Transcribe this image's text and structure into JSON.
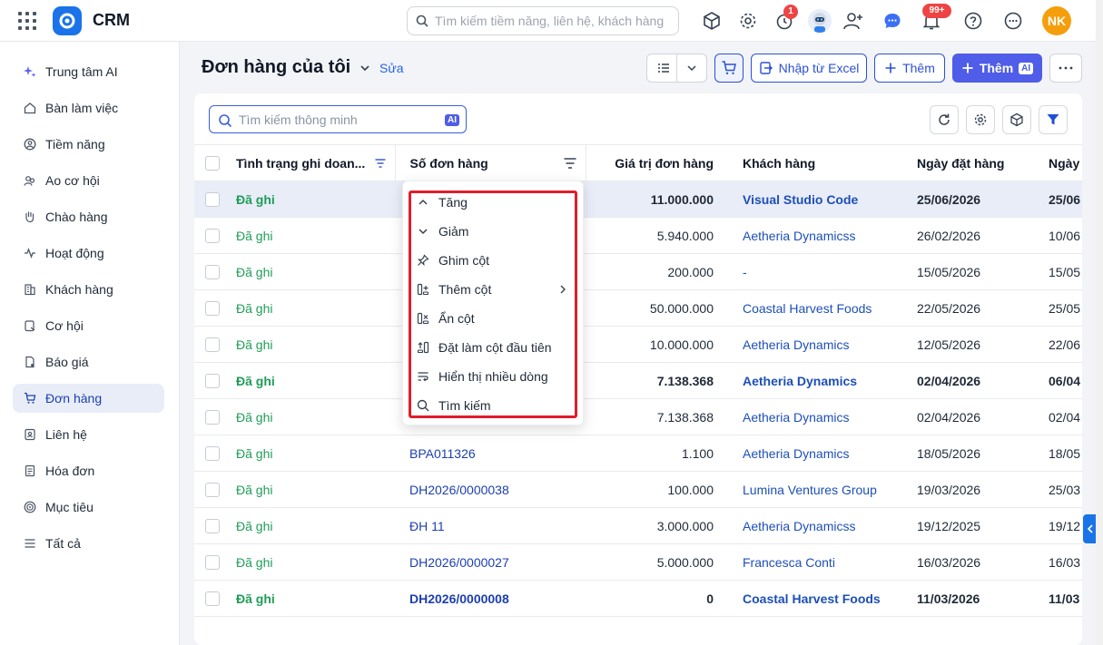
{
  "app": {
    "name": "CRM"
  },
  "topbar": {
    "search_placeholder": "Tìm kiếm tiềm năng, liên hệ, khách hàng",
    "timer_badge": "1",
    "notif_badge": "99+",
    "user_initials": "NK"
  },
  "sidebar": {
    "items": [
      {
        "label": "Trung tâm AI",
        "icon": "sparkle-icon"
      },
      {
        "label": "Bàn làm việc",
        "icon": "home-icon"
      },
      {
        "label": "Tiềm năng",
        "icon": "target-person-icon"
      },
      {
        "label": "Ao cơ hội",
        "icon": "users-icon"
      },
      {
        "label": "Chào hàng",
        "icon": "hand-icon"
      },
      {
        "label": "Hoạt động",
        "icon": "activity-icon"
      },
      {
        "label": "Khách hàng",
        "icon": "building-icon"
      },
      {
        "label": "Cơ hội",
        "icon": "opportunity-icon"
      },
      {
        "label": "Báo giá",
        "icon": "quote-icon"
      },
      {
        "label": "Đơn hàng",
        "icon": "cart-icon"
      },
      {
        "label": "Liên hệ",
        "icon": "contact-icon"
      },
      {
        "label": "Hóa đơn",
        "icon": "invoice-icon"
      },
      {
        "label": "Mục tiêu",
        "icon": "goal-icon"
      },
      {
        "label": "Tất cả",
        "icon": "menu-icon"
      }
    ],
    "active_index": 9
  },
  "header": {
    "title": "Đơn hàng của tôi",
    "edit_label": "Sửa",
    "import_label": "Nhập từ Excel",
    "add_label": "Thêm",
    "add_ai_label": "Thêm",
    "ai_chip": "AI"
  },
  "toolbar": {
    "smart_search_placeholder": "Tìm kiếm thông minh",
    "ai_chip": "AI"
  },
  "table": {
    "columns": [
      "Tình trạng ghi doan...",
      "Số đơn hàng",
      "Giá trị đơn hàng",
      "Khách hàng",
      "Ngày đặt hàng",
      "Ngày"
    ],
    "rows": [
      {
        "status": "Đã ghi",
        "order": "",
        "value": "11.000.000",
        "customer": "Visual Studio Code",
        "date": "25/06/2026",
        "date2": "25/06",
        "bold": true,
        "highlight": true
      },
      {
        "status": "Đã ghi",
        "order": "",
        "value": "5.940.000",
        "customer": "Aetheria Dynamicss",
        "date": "26/02/2026",
        "date2": "10/06",
        "bold": false
      },
      {
        "status": "Đã ghi",
        "order": "",
        "value": "200.000",
        "customer": "-",
        "date": "15/05/2026",
        "date2": "15/05",
        "bold": false
      },
      {
        "status": "Đã ghi",
        "order": "",
        "value": "50.000.000",
        "customer": "Coastal Harvest Foods",
        "date": "22/05/2026",
        "date2": "25/05",
        "bold": false
      },
      {
        "status": "Đã ghi",
        "order": "",
        "value": "10.000.000",
        "customer": "Aetheria Dynamics",
        "date": "12/05/2026",
        "date2": "22/06",
        "bold": false
      },
      {
        "status": "Đã ghi",
        "order": "",
        "value": "7.138.368",
        "customer": "Aetheria Dynamics",
        "date": "02/04/2026",
        "date2": "06/04",
        "bold": true
      },
      {
        "status": "Đã ghi",
        "order": "",
        "value": "7.138.368",
        "customer": "Aetheria Dynamics",
        "date": "02/04/2026",
        "date2": "02/04",
        "bold": false
      },
      {
        "status": "Đã ghi",
        "order": "BPA011326",
        "value": "1.100",
        "customer": "Aetheria Dynamics",
        "date": "18/05/2026",
        "date2": "18/05",
        "bold": false
      },
      {
        "status": "Đã ghi",
        "order": "DH2026/0000038",
        "value": "100.000",
        "customer": "Lumina Ventures Group",
        "date": "19/03/2026",
        "date2": "25/03",
        "bold": false
      },
      {
        "status": "Đã ghi",
        "order": "ĐH 11",
        "value": "3.000.000",
        "customer": "Aetheria Dynamicss",
        "date": "19/12/2025",
        "date2": "19/12",
        "bold": false
      },
      {
        "status": "Đã ghi",
        "order": "DH2026/0000027",
        "value": "5.000.000",
        "customer": "Francesca Conti",
        "date": "16/03/2026",
        "date2": "16/03",
        "bold": false
      },
      {
        "status": "Đã ghi",
        "order": "DH2026/0000008",
        "value": "0",
        "customer": "Coastal Harvest Foods",
        "date": "11/03/2026",
        "date2": "11/03",
        "bold": true
      }
    ]
  },
  "column_menu": {
    "items": [
      {
        "label": "Tăng",
        "icon": "chevron-up-icon"
      },
      {
        "label": "Giảm",
        "icon": "chevron-down-icon"
      },
      {
        "label": "Ghim cột",
        "icon": "pin-icon"
      },
      {
        "label": "Thêm cột",
        "icon": "add-column-icon",
        "has_submenu": true
      },
      {
        "label": "Ẩn cột",
        "icon": "hide-column-icon"
      },
      {
        "label": "Đặt làm cột đầu tiên",
        "icon": "first-column-icon"
      },
      {
        "label": "Hiển thị nhiều dòng",
        "icon": "wrap-text-icon"
      },
      {
        "label": "Tìm kiếm",
        "icon": "search-icon"
      }
    ]
  },
  "colors": {
    "accent": "#2b50d6",
    "primary_button": "#4f5de8",
    "status_green": "#1f9d57",
    "highlight_border": "#e11d2a"
  }
}
